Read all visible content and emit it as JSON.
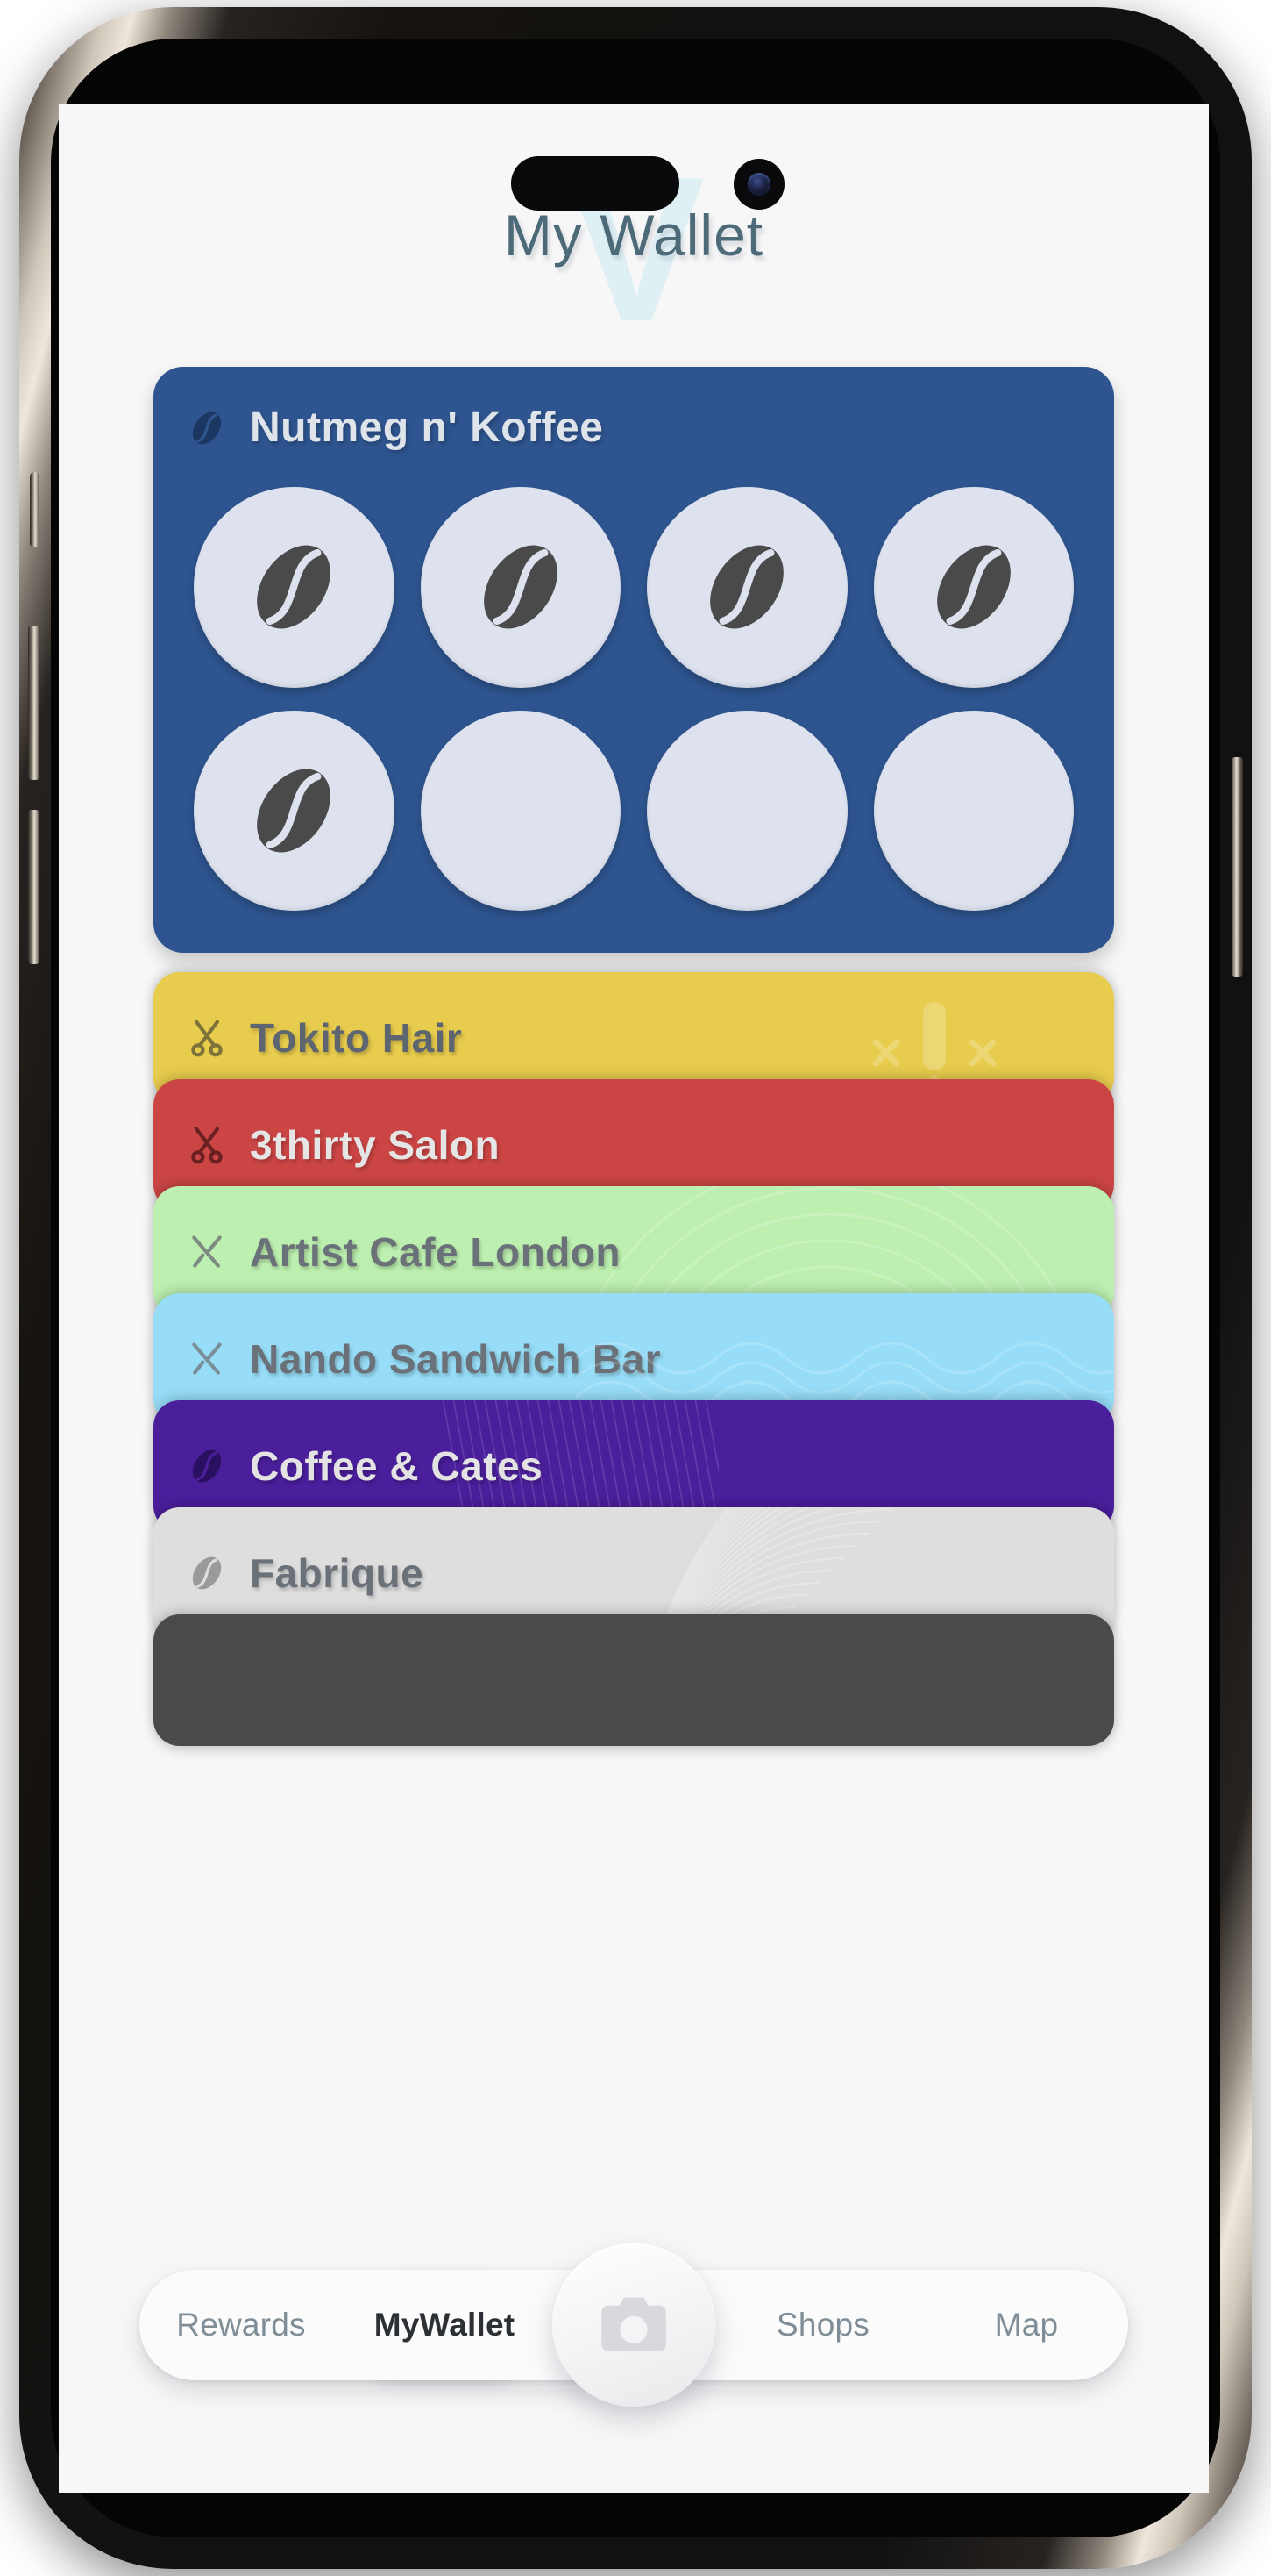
{
  "header": {
    "title": "My Wallet",
    "watermark_letter": "V"
  },
  "hero_card": {
    "name": "Nutmeg n' Koffee",
    "icon": "coffee-bean-icon",
    "bg_color": "#2e5590",
    "text_color": "#dfe3ea",
    "icon_color": "#1d3763",
    "stamps_total": 8,
    "stamps_filled": 5,
    "stamp_bg": "#dde2ee",
    "stamp_bean_color": "#4a4a4a"
  },
  "cards": [
    {
      "name": "Tokito Hair",
      "icon": "scissors-icon",
      "bg_color": "#e8cc4d",
      "text_color": "#5d6670",
      "icon_color": "#7d7237",
      "decoration": "scissors-watermark"
    },
    {
      "name": "3thirty Salon",
      "icon": "scissors-icon",
      "bg_color": "#cc4545",
      "text_color": "#e5e5e5",
      "icon_color": "#6a2020",
      "decoration": "none"
    },
    {
      "name": "Artist Cafe London",
      "icon": "cutlery-icon",
      "bg_color": "#bdf0b0",
      "text_color": "#6b7178",
      "icon_color": "#7e8b82",
      "decoration": "arcs-watermark"
    },
    {
      "name": "Nando Sandwich Bar",
      "icon": "cutlery-icon",
      "bg_color": "#97ddf7",
      "text_color": "#6b7178",
      "icon_color": "#7b8f98",
      "decoration": "waves-watermark"
    },
    {
      "name": "Coffee & Cates",
      "icon": "coffee-bean-icon",
      "bg_color": "#4b1e9c",
      "text_color": "#e3e3e3",
      "icon_color": "#2a1060",
      "decoration": "lines-watermark"
    },
    {
      "name": "Fabrique",
      "icon": "coffee-bean-icon",
      "bg_color": "#dedede",
      "text_color": "#6b7178",
      "icon_color": "#9a9a9a",
      "decoration": "fan-watermark"
    },
    {
      "name": "",
      "icon": "none",
      "bg_color": "#4a4a4a",
      "text_color": "#e0e0e0",
      "icon_color": "#2a2a2a",
      "decoration": "none"
    }
  ],
  "bottom_nav": {
    "items": [
      {
        "label": "Rewards",
        "active": false
      },
      {
        "label": "MyWallet",
        "active": true
      },
      {
        "label": "Shops",
        "active": false
      },
      {
        "label": "Map",
        "active": false
      }
    ],
    "fab": {
      "icon": "camera-icon",
      "color": "#d9d9dd"
    }
  }
}
